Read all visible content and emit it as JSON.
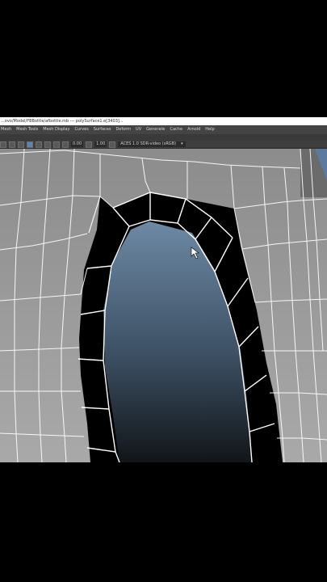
{
  "window": {
    "title": "...ovo/Model/FBBottle/afbottle.mb  ---  polySurface1.e[3403]..."
  },
  "menu": {
    "items": [
      {
        "label": "Mesh"
      },
      {
        "label": "Mesh Tools"
      },
      {
        "label": "Mesh Display"
      },
      {
        "label": "Curves"
      },
      {
        "label": "Surfaces"
      },
      {
        "label": "Deform"
      },
      {
        "label": "UV"
      },
      {
        "label": "Generate"
      },
      {
        "label": "Cache"
      },
      {
        "label": "Arnold"
      },
      {
        "label": "Help"
      }
    ]
  },
  "toolbar": {
    "field_a": "0.00",
    "field_b": "1.00",
    "color_space": "ACES 1.0 SDR-video (sRGB)"
  },
  "colors": {
    "surface": "#8a8a8a",
    "wire": "#ffffff",
    "hole_top": "#6f8aa6",
    "hole_bottom": "#141a20",
    "rim": "#000000"
  }
}
